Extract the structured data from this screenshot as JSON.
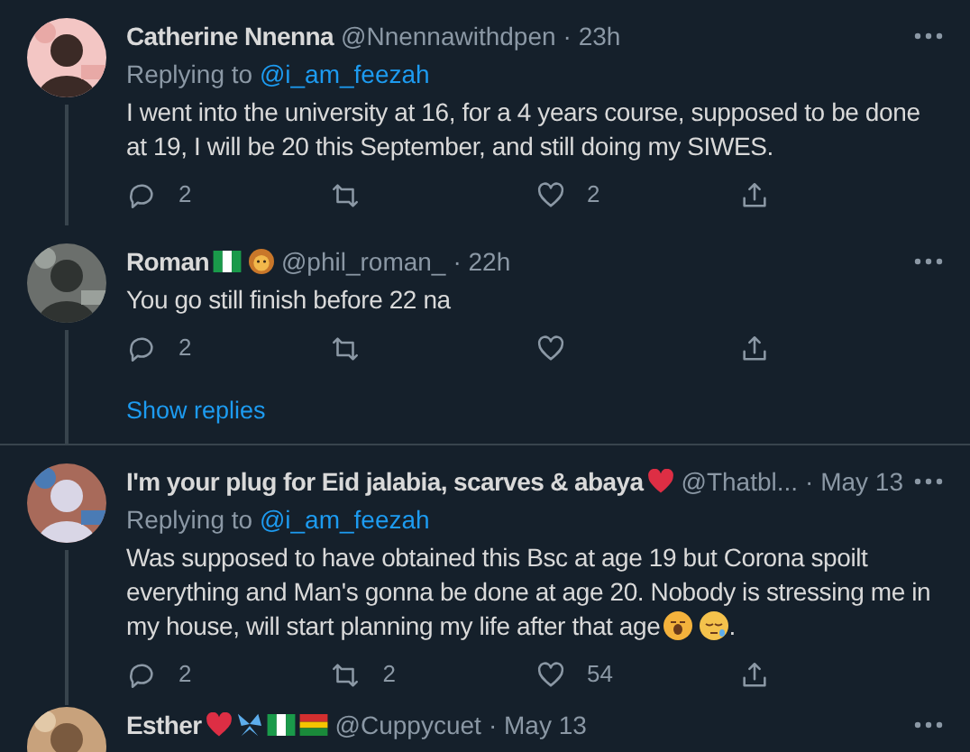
{
  "tweets": [
    {
      "name": "Catherine Nnenna",
      "handle": "@Nnennawithdpen",
      "time": "· 23h",
      "replying_label": "Replying to",
      "replying_to": "@i_am_feezah",
      "body": "I went into the university at 16, for a 4 years course, supposed to be done at 19, I will be 20 this September, and still doing my SIWES.",
      "replies": "2",
      "likes": "2"
    },
    {
      "name": "Roman",
      "handle": "@phil_roman_",
      "time": "· 22h",
      "body": "You go still finish before 22 na",
      "replies": "2",
      "show_replies": "Show replies"
    },
    {
      "name": "I'm your plug for Eid jalabia, scarves & abaya",
      "handle": "@Thatbl...",
      "time": "· May 13",
      "replying_label": "Replying to",
      "replying_to": "@i_am_feezah",
      "body": "Was supposed to have obtained this Bsc at age 19 but Corona spoilt everything and Man's gonna be done at age 20. Nobody is stressing me in my house, will start planning my life after that age",
      "body_end": ".",
      "replies": "2",
      "retweets": "2",
      "likes": "54"
    },
    {
      "name": "Esther",
      "handle": "@Cuppycuet",
      "time": "· May 13"
    }
  ]
}
